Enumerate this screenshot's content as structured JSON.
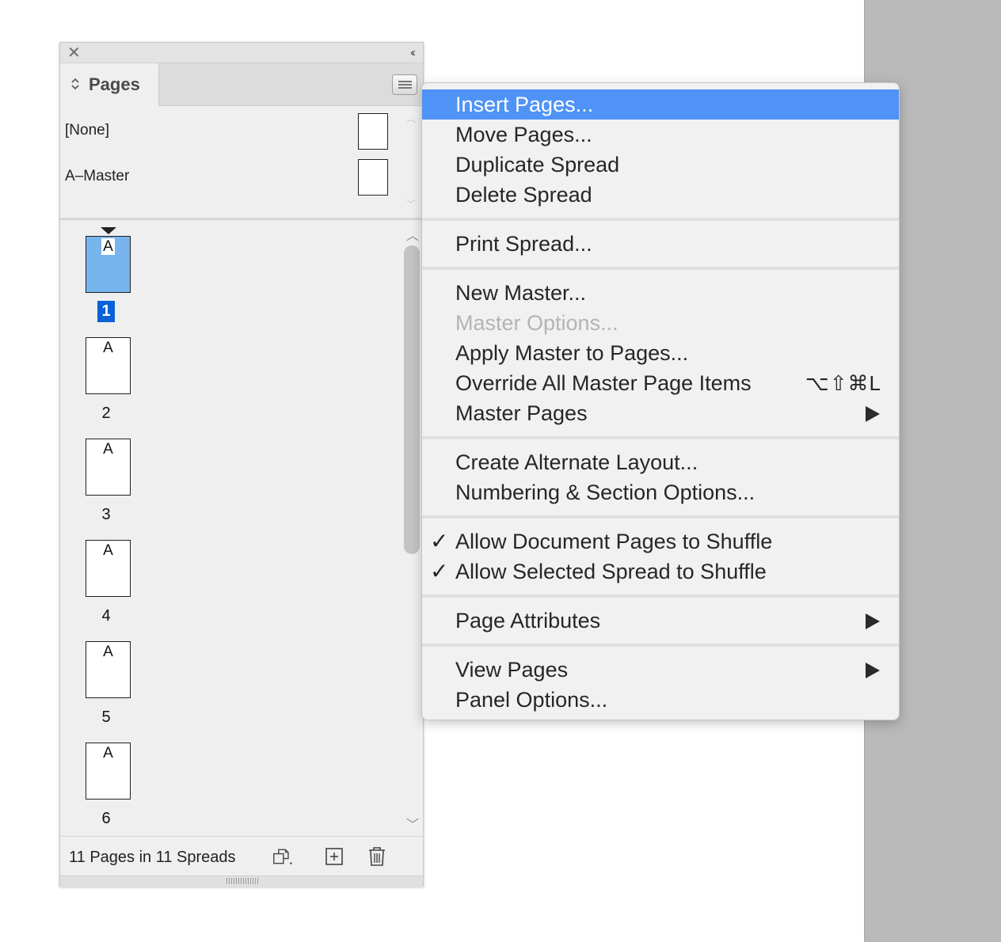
{
  "panel": {
    "tab_label": "Pages",
    "masters": [
      {
        "label": "[None]"
      },
      {
        "label": "A–Master"
      }
    ],
    "pages": [
      {
        "master": "A",
        "number": "1",
        "selected": true
      },
      {
        "master": "A",
        "number": "2"
      },
      {
        "master": "A",
        "number": "3"
      },
      {
        "master": "A",
        "number": "4"
      },
      {
        "master": "A",
        "number": "5"
      },
      {
        "master": "A",
        "number": "6"
      }
    ],
    "footer_status": "11 Pages in 11 Spreads",
    "icons": [
      "close-icon",
      "collapse-icon",
      "panel-menu-icon",
      "edit-page-size-icon",
      "new-page-icon",
      "trash-icon"
    ]
  },
  "menu": {
    "items": [
      {
        "label": "Insert Pages...",
        "highlighted": true
      },
      {
        "label": "Move Pages..."
      },
      {
        "label": "Duplicate Spread"
      },
      {
        "label": "Delete Spread"
      },
      {
        "label": "Print Spread..."
      },
      {
        "label": "New Master..."
      },
      {
        "label": "Master Options...",
        "disabled": true
      },
      {
        "label": "Apply Master to Pages..."
      },
      {
        "label": "Override All Master Page Items",
        "shortcut": "⌥⇧⌘L"
      },
      {
        "label": "Master Pages",
        "submenu": true
      },
      {
        "label": "Create Alternate Layout..."
      },
      {
        "label": "Numbering & Section Options..."
      },
      {
        "label": "Allow Document Pages to Shuffle",
        "checked": true
      },
      {
        "label": "Allow Selected Spread to Shuffle",
        "checked": true
      },
      {
        "label": "Page Attributes",
        "submenu": true
      },
      {
        "label": "View Pages",
        "submenu": true
      },
      {
        "label": "Panel Options..."
      }
    ],
    "check_glyph": "✓"
  },
  "colors": {
    "highlight": "#4f93f6",
    "selected_page": "#78b5ee",
    "selected_number": "#0a62d6"
  }
}
